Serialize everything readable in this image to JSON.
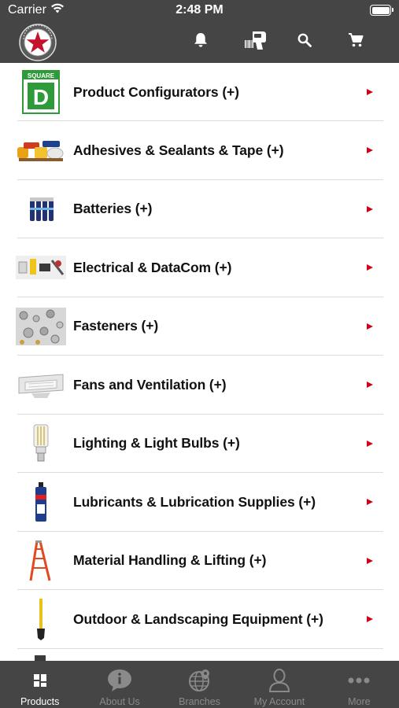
{
  "status_bar": {
    "carrier": "Carrier",
    "time": "2:48 PM"
  },
  "header": {
    "logo_icon": "star-seal-logo-icon",
    "toolbar": [
      {
        "name": "notifications-button",
        "icon": "bell-icon"
      },
      {
        "name": "barcode-scanner-button",
        "icon": "barcode-scanner-icon"
      },
      {
        "name": "search-button",
        "icon": "search-icon"
      },
      {
        "name": "cart-button",
        "icon": "cart-icon"
      }
    ]
  },
  "colors": {
    "header_bg": "#454545",
    "accent": "#d0021b",
    "tab_active": "#ffffff",
    "tab_inactive": "#8a8a8a"
  },
  "categories": [
    {
      "label": "Product Configurators (+)",
      "icon": "square-d-logo-icon"
    },
    {
      "label": "Adhesives & Sealants & Tape (+)",
      "icon": "adhesives-icon"
    },
    {
      "label": "Batteries  (+)",
      "icon": "batteries-icon"
    },
    {
      "label": "Electrical & DataCom (+)",
      "icon": "electrical-icon"
    },
    {
      "label": "Fasteners (+)",
      "icon": "fasteners-icon"
    },
    {
      "label": "Fans and Ventilation (+)",
      "icon": "fan-icon"
    },
    {
      "label": "Lighting & Light Bulbs (+)",
      "icon": "light-bulb-icon"
    },
    {
      "label": "Lubricants & Lubrication Supplies (+)",
      "icon": "lubricant-can-icon"
    },
    {
      "label": "Material Handling & Lifting (+)",
      "icon": "ladder-icon"
    },
    {
      "label": "Outdoor & Landscaping Equipment (+)",
      "icon": "shovel-icon"
    }
  ],
  "tabs": [
    {
      "label": "Products",
      "icon": "grid-icon",
      "active": true
    },
    {
      "label": "About Us",
      "icon": "info-icon",
      "active": false
    },
    {
      "label": "Branches",
      "icon": "globe-pin-icon",
      "active": false
    },
    {
      "label": "My Account",
      "icon": "person-icon",
      "active": false
    },
    {
      "label": "More",
      "icon": "ellipsis-icon",
      "active": false
    }
  ]
}
